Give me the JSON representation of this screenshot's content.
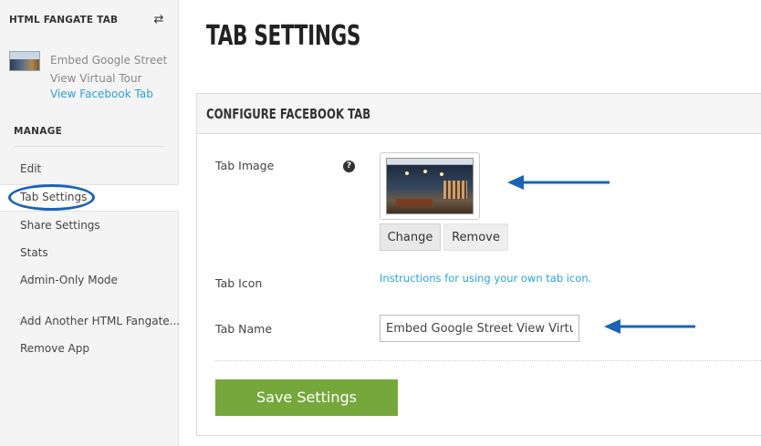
{
  "sidebar": {
    "header": "HTML FANGATE TAB",
    "swap_icon": "swap-arrows-icon",
    "app": {
      "name": "Embed Google Street View Virtual Tour",
      "link": "View Facebook Tab"
    },
    "manage_label": "MANAGE",
    "items": [
      {
        "label": "Edit"
      },
      {
        "label": "Tab Settings",
        "active": true
      },
      {
        "label": "Share Settings"
      },
      {
        "label": "Stats"
      },
      {
        "label": "Admin-Only Mode"
      },
      {
        "label": "Add Another HTML Fangate..."
      },
      {
        "label": "Remove App"
      }
    ]
  },
  "main": {
    "title": "TAB SETTINGS",
    "panel_title": "CONFIGURE FACEBOOK TAB",
    "fields": {
      "tab_image": {
        "label": "Tab Image",
        "help_icon": "question-circle-icon",
        "change_label": "Change",
        "remove_label": "Remove"
      },
      "tab_icon": {
        "label": "Tab Icon",
        "link": "Instructions for using your own tab icon."
      },
      "tab_name": {
        "label": "Tab Name",
        "value": "Embed Google Street View Virtual Tour"
      }
    },
    "save_label": "Save Settings"
  },
  "colors": {
    "accent_link": "#2aa3d8",
    "save_button": "#76a73b",
    "annotation": "#1a64b8"
  }
}
